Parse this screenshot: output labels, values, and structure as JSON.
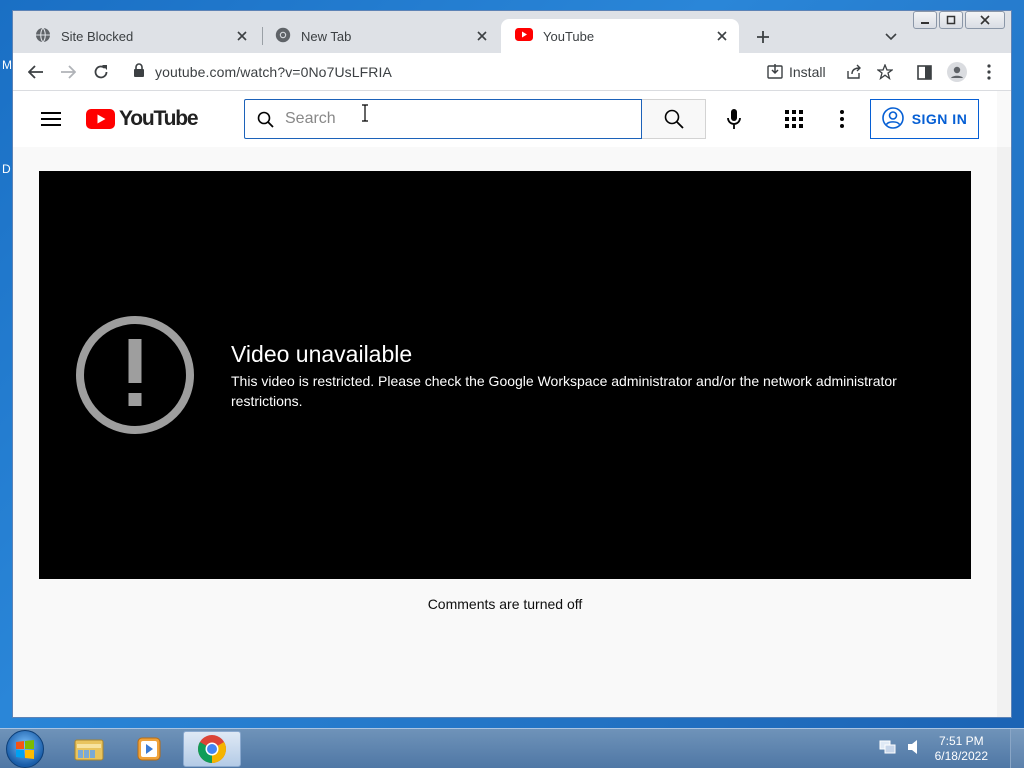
{
  "desktop": {
    "letters": [
      "M",
      "D"
    ]
  },
  "tabs": [
    {
      "title": "Site Blocked",
      "icon": "globe-icon",
      "active": false
    },
    {
      "title": "New Tab",
      "icon": "chrome-icon",
      "active": false
    },
    {
      "title": "YouTube",
      "icon": "youtube-icon",
      "active": true
    }
  ],
  "toolbar": {
    "url": "youtube.com/watch?v=0No7UsLFRIA",
    "install_label": "Install"
  },
  "youtube": {
    "logo_text": "YouTube",
    "search_placeholder": "Search",
    "sign_in_label": "SIGN IN",
    "brand_color": "#ff0000",
    "accent_color": "#065fd4"
  },
  "player": {
    "error_title": "Video unavailable",
    "error_message": "This video is restricted. Please check the Google Workspace administrator and/or the network administrator restrictions."
  },
  "comments_text": "Comments are turned off",
  "taskbar": {
    "apps": [
      "explorer-icon",
      "media-player-icon",
      "chrome-icon"
    ],
    "active_app": "chrome-icon",
    "time": "7:51 PM",
    "date": "6/18/2022"
  }
}
